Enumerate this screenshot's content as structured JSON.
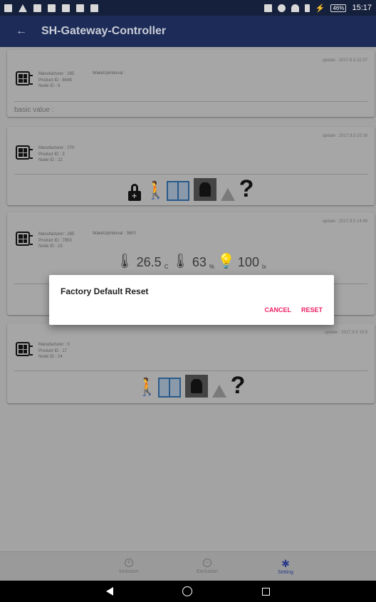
{
  "status": {
    "battery": "46%",
    "time": "15:17"
  },
  "app": {
    "title": "SH-Gateway-Controller"
  },
  "cards": [
    {
      "update": "update : 2017.9.3 22:37",
      "manufacturer": "Manufacturer : 265",
      "product": "Product ID : 8449",
      "node": "Node ID : 9",
      "wakeup": "WakeUpInterval :",
      "basic": "basic value :"
    },
    {
      "update": "update : 2017.9.5 15:16",
      "manufacturer": "Manufacturer : 270",
      "product": "Product ID : 3",
      "node": "Node ID : 22"
    },
    {
      "update": "update : 2017.9.5 14:49",
      "manufacturer": "Manufacturer : 265",
      "product": "Product ID : 7953",
      "node": "Node ID : 23",
      "wakeup": "WakeUpInterval : 3600",
      "temp": "26.5",
      "temp_unit": "C",
      "humidity": "63",
      "humidity_unit": "%",
      "lux": "100",
      "lux_unit": "lx"
    },
    {
      "update": "update : 2017.9.5 15:9",
      "manufacturer": "Manufacturer : 0",
      "product": "Product ID : 17",
      "node": "Node ID : 24"
    }
  ],
  "dialog": {
    "title": "Factory Default Reset",
    "cancel": "CANCEL",
    "reset": "RESET"
  },
  "bottom_nav": [
    {
      "label": "Inclusion",
      "icon": "plus-circle-icon"
    },
    {
      "label": "Exclusion",
      "icon": "minus-circle-icon"
    },
    {
      "label": "Setting",
      "icon": "gear-icon"
    }
  ],
  "colors": {
    "appbar": "#1c2b57",
    "accent": "#e91e63",
    "active_nav": "#2b3a8a"
  }
}
